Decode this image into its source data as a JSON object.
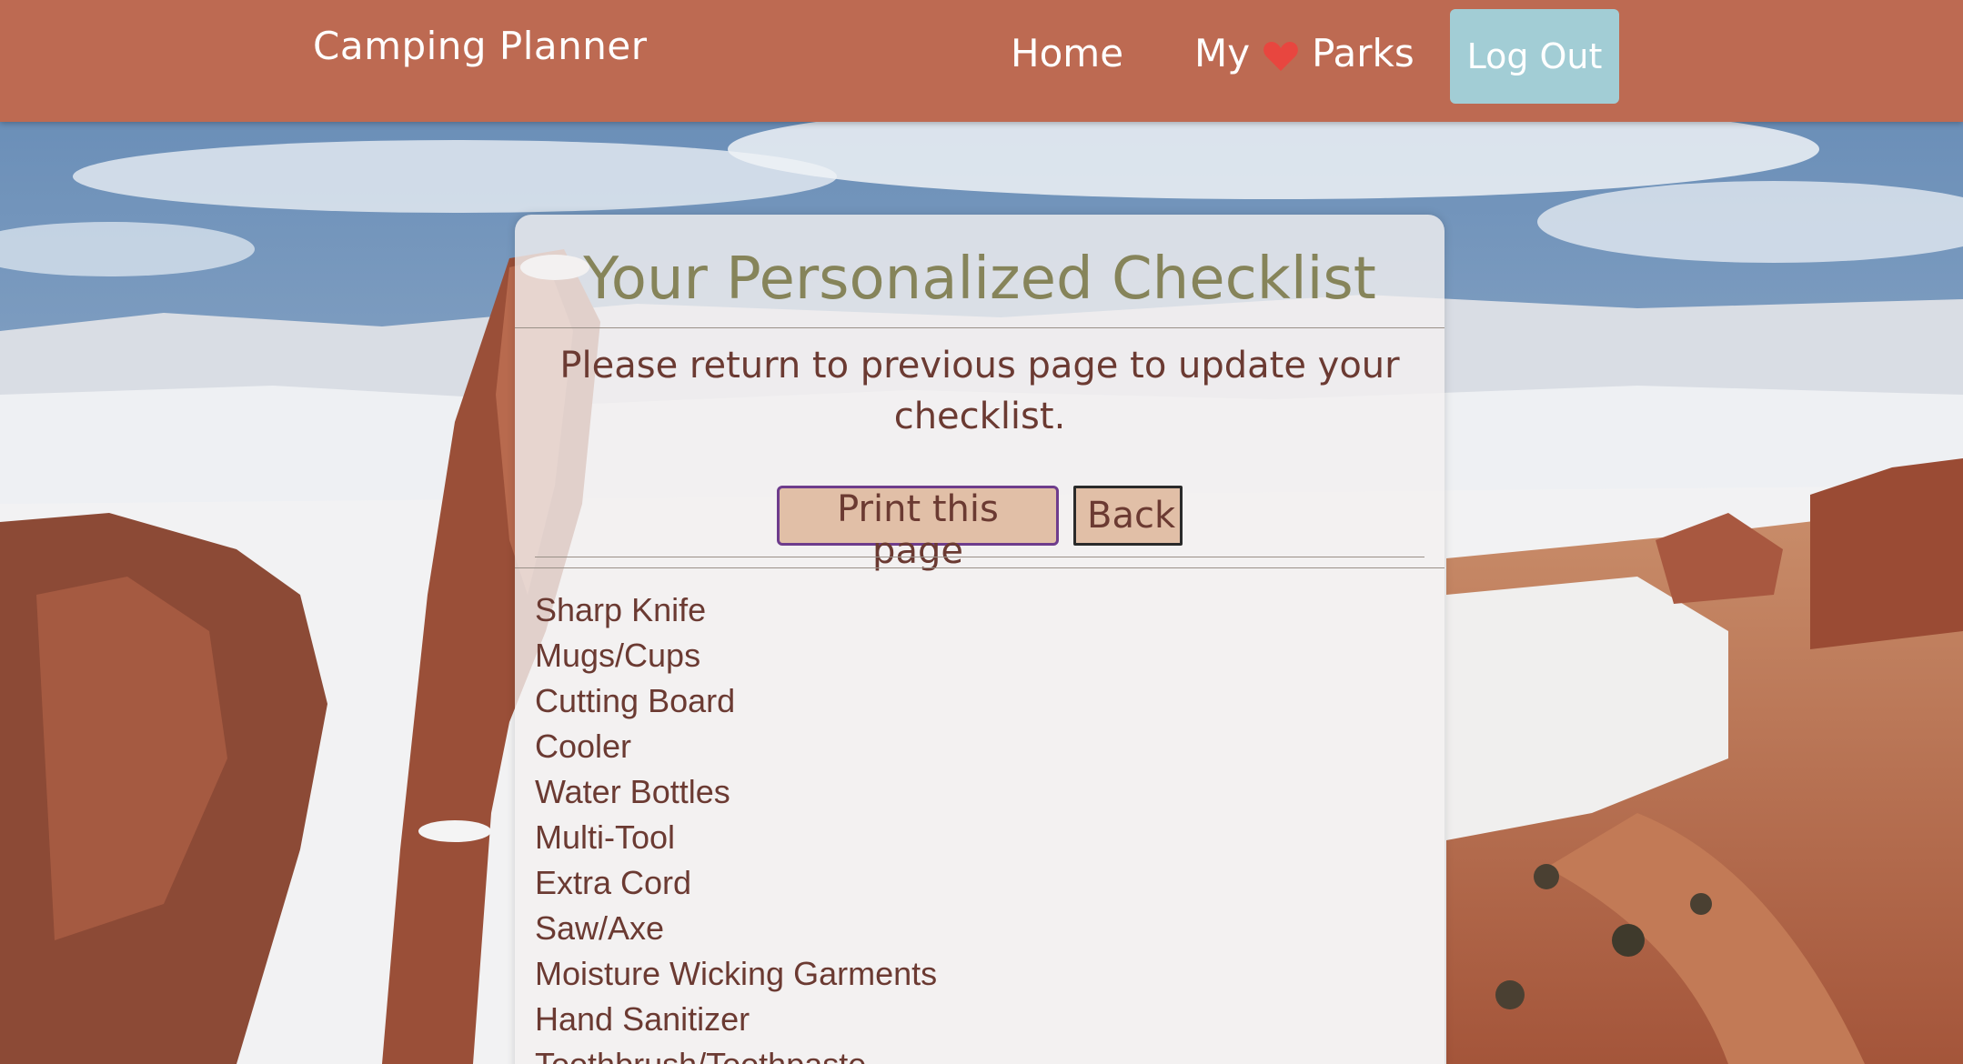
{
  "navbar": {
    "brand": "Camping Planner",
    "home_label": "Home",
    "my_label": "My",
    "parks_label": "Parks",
    "logout_label": "Log Out",
    "color": "#bd6a52",
    "logout_color": "#a2cdd5",
    "heart_color": "#e8463f"
  },
  "checklist": {
    "title": "Your Personalized Checklist",
    "instructions": "Please return to previous page to update your checklist.",
    "print_label": "Print this page",
    "back_label": "Back",
    "items": [
      "Sharp Knife",
      "Mugs/Cups",
      "Cutting Board",
      "Cooler",
      "Water Bottles",
      "Multi-Tool",
      "Extra Cord",
      "Saw/Axe",
      "Moisture Wicking Garments",
      "Hand Sanitizer",
      "Toothbrush/Toothpaste"
    ]
  },
  "background": {
    "subject": "snowy red-rock desert arch landscape under cloudy blue sky"
  }
}
